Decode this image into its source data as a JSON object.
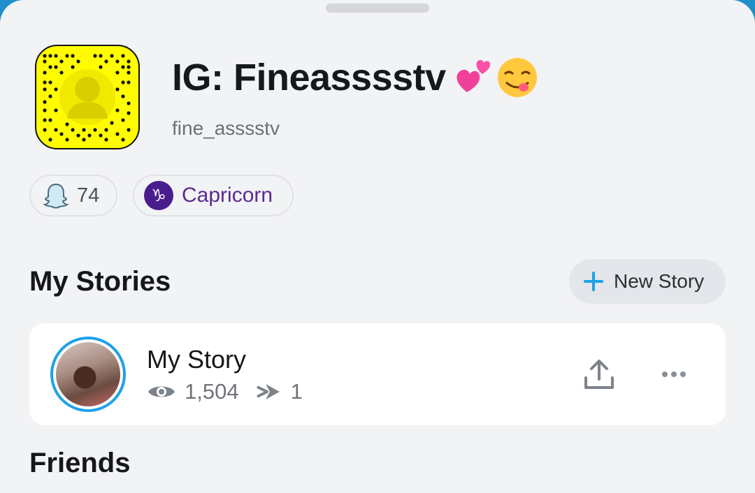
{
  "profile": {
    "display_name": "IG: Fineasssstv",
    "display_emojis": [
      "heart-icon",
      "smiling-face-icon"
    ],
    "username": "fine_asssstv",
    "snapcode_color": "#fffc00"
  },
  "badges": {
    "snap_score": "74",
    "zodiac_label": "Capricorn",
    "zodiac_symbol": "♑"
  },
  "my_stories": {
    "title": "My Stories",
    "new_story_label": "New Story"
  },
  "story": {
    "title": "My Story",
    "views": "1,504",
    "screenshots": "1"
  },
  "friends": {
    "title": "Friends"
  },
  "colors": {
    "accent": "#1ea1e8",
    "zodiac": "#4a1d8c"
  }
}
